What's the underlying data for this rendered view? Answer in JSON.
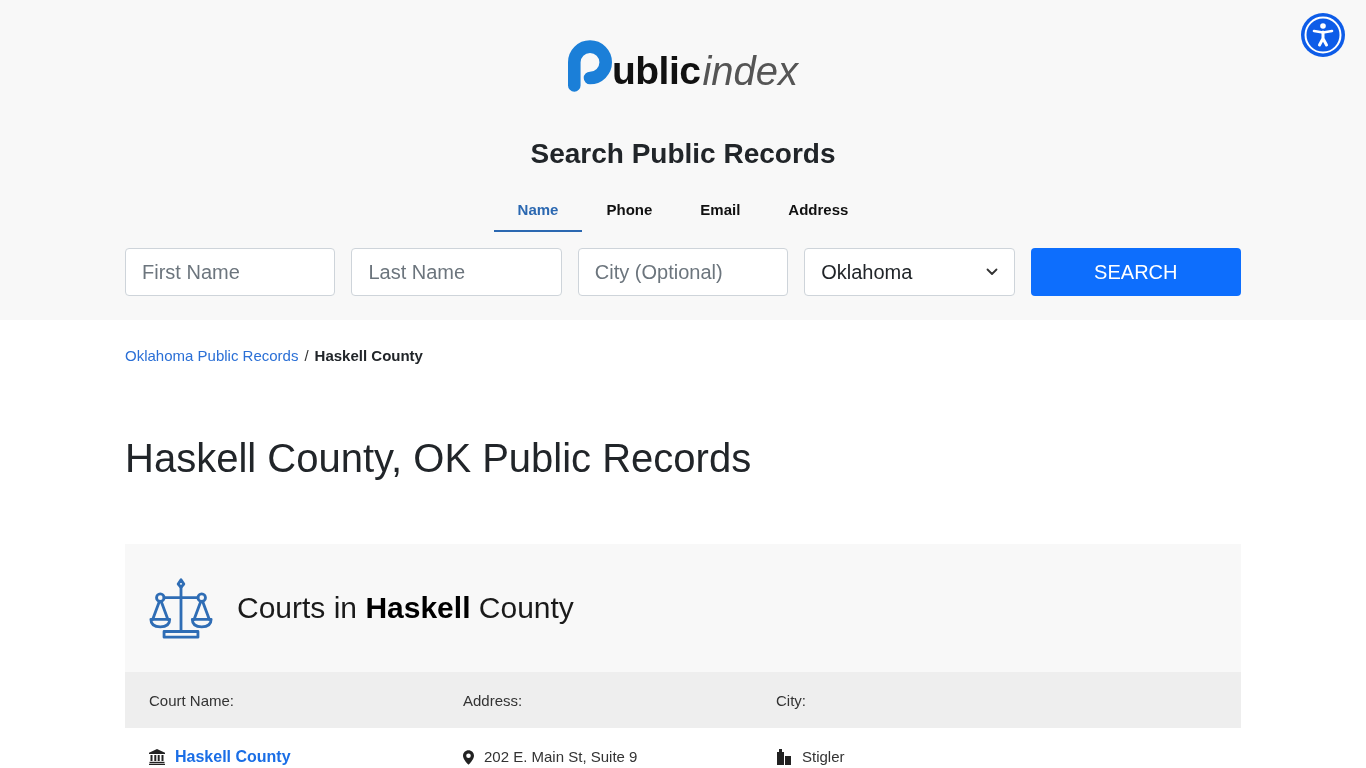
{
  "logo": {
    "bold_text": "ublic",
    "light_text": "index"
  },
  "search": {
    "title": "Search Public Records",
    "tabs": [
      {
        "label": "Name",
        "selected": true
      },
      {
        "label": "Phone",
        "selected": false
      },
      {
        "label": "Email",
        "selected": false
      },
      {
        "label": "Address",
        "selected": false
      }
    ],
    "fields": [
      {
        "kind": "text",
        "placeholder": "First Name"
      },
      {
        "kind": "text",
        "placeholder": "Last Name"
      },
      {
        "kind": "text",
        "placeholder": "City (Optional)"
      },
      {
        "kind": "select",
        "value": "Oklahoma"
      }
    ],
    "button": "SEARCH"
  },
  "breadcrumb": {
    "separator": "/",
    "items": [
      {
        "kind": "link",
        "label": "Oklahoma Public Records"
      },
      {
        "kind": "current",
        "label": "Haskell County"
      }
    ]
  },
  "page_title": "Haskell County, OK Public Records",
  "courts": {
    "heading": "Courts in **Haskell** County",
    "columns": [
      "Court Name:",
      "Address:",
      "City:"
    ],
    "rows": [
      {
        "name": "Haskell County",
        "address": "202 E. Main St, Suite 9",
        "city": "Stigler"
      }
    ]
  }
}
